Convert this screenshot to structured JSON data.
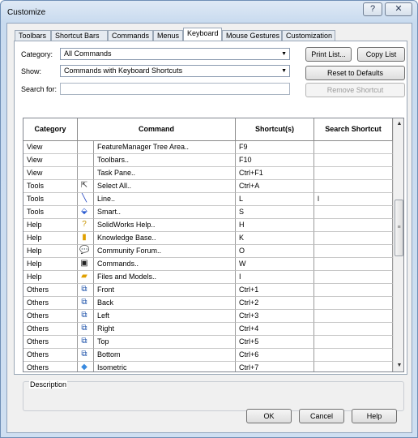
{
  "window": {
    "title": "Customize",
    "help_glyph": "?",
    "close_glyph": "✕"
  },
  "tabs": [
    "Toolbars",
    "Shortcut Bars",
    "Commands",
    "Menus",
    "Keyboard",
    "Mouse Gestures",
    "Customization"
  ],
  "active_tab": "Keyboard",
  "filters": {
    "category_label": "Category:",
    "category_value": "All Commands",
    "show_label": "Show:",
    "show_value": "Commands with Keyboard Shortcuts",
    "search_label": "Search for:",
    "search_value": ""
  },
  "buttons": {
    "print_list": "Print List...",
    "copy_list": "Copy List",
    "reset_defaults": "Reset to Defaults",
    "remove_shortcut": "Remove Shortcut",
    "ok": "OK",
    "cancel": "Cancel",
    "help": "Help"
  },
  "table": {
    "headers": {
      "category": "Category",
      "command": "Command",
      "shortcuts": "Shortcut(s)",
      "search_shortcut": "Search Shortcut"
    },
    "rows": [
      {
        "category": "View",
        "icon": "none",
        "command": "FeatureManager Tree Area..",
        "shortcut": "F9",
        "search": ""
      },
      {
        "category": "View",
        "icon": "none",
        "command": "Toolbars..",
        "shortcut": "F10",
        "search": ""
      },
      {
        "category": "View",
        "icon": "none",
        "command": "Task Pane..",
        "shortcut": "Ctrl+F1",
        "search": ""
      },
      {
        "category": "Tools",
        "icon": "select-cursor-icon",
        "command": "Select All..",
        "shortcut": "Ctrl+A",
        "search": ""
      },
      {
        "category": "Tools",
        "icon": "line-sketch-icon",
        "command": "Line..",
        "shortcut": "L",
        "search": "l"
      },
      {
        "category": "Tools",
        "icon": "smart-dimension-icon",
        "command": "Smart..",
        "shortcut": "S",
        "search": ""
      },
      {
        "category": "Help",
        "icon": "solidworks-help-icon",
        "command": "SolidWorks Help..",
        "shortcut": "H",
        "search": ""
      },
      {
        "category": "Help",
        "icon": "knowledge-base-icon",
        "command": "Knowledge Base..",
        "shortcut": "K",
        "search": ""
      },
      {
        "category": "Help",
        "icon": "community-forum-icon",
        "command": "Community Forum..",
        "shortcut": "O",
        "search": ""
      },
      {
        "category": "Help",
        "icon": "commands-console-icon",
        "command": "Commands..",
        "shortcut": "W",
        "search": ""
      },
      {
        "category": "Help",
        "icon": "files-models-folder-icon",
        "command": "Files and Models..",
        "shortcut": "I",
        "search": ""
      },
      {
        "category": "Others",
        "icon": "front-view-cube-icon",
        "command": "Front",
        "shortcut": "Ctrl+1",
        "search": ""
      },
      {
        "category": "Others",
        "icon": "back-view-cube-icon",
        "command": "Back",
        "shortcut": "Ctrl+2",
        "search": ""
      },
      {
        "category": "Others",
        "icon": "left-view-cube-icon",
        "command": "Left",
        "shortcut": "Ctrl+3",
        "search": ""
      },
      {
        "category": "Others",
        "icon": "right-view-cube-icon",
        "command": "Right",
        "shortcut": "Ctrl+4",
        "search": ""
      },
      {
        "category": "Others",
        "icon": "top-view-cube-icon",
        "command": "Top",
        "shortcut": "Ctrl+5",
        "search": ""
      },
      {
        "category": "Others",
        "icon": "bottom-view-cube-icon",
        "command": "Bottom",
        "shortcut": "Ctrl+6",
        "search": ""
      },
      {
        "category": "Others",
        "icon": "isometric-view-cube-icon",
        "command": "Isometric",
        "shortcut": "Ctrl+7",
        "search": ""
      }
    ]
  },
  "description": {
    "label": "Description"
  }
}
